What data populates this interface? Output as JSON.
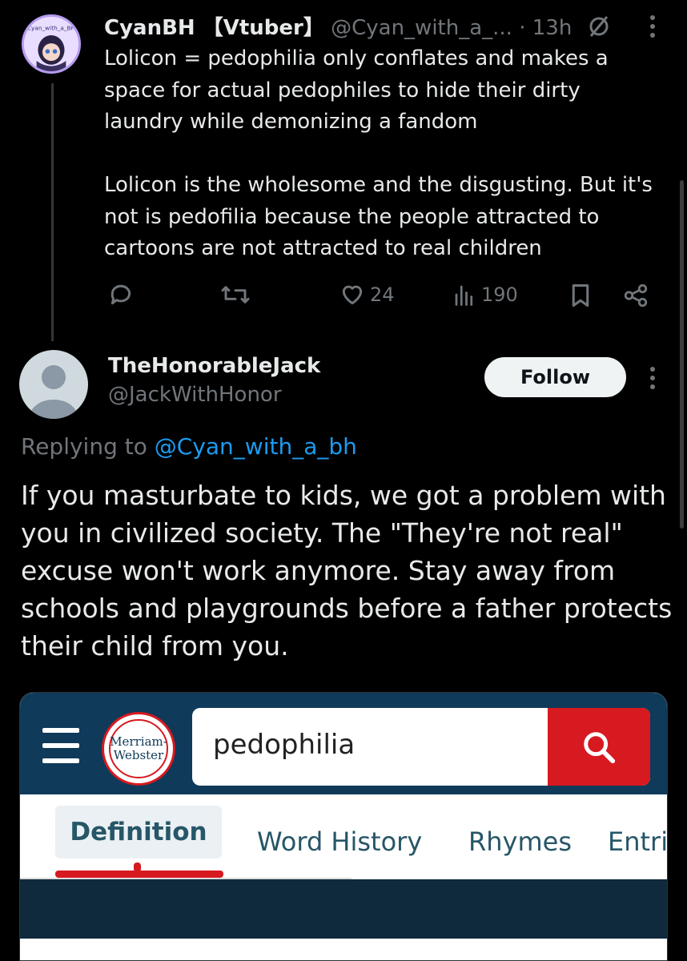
{
  "tweet": {
    "display_name": "CyanBH 【Vtuber】",
    "handle_time": "@Cyan_with_a_... · 13h",
    "avatar_text": "Cyan_with_a_BH",
    "text": "Lolicon = pedophilia only conflates and makes a\nspace for actual pedophiles to hide their dirty\nlaundry while demonizing a fandom\n\nLolicon is the wholesome and the disgusting. But it's\nnot is pedofilia because the people attracted to\ncartoons are not attracted to real children",
    "likes": "24",
    "views": "190",
    "icons": [
      "reply-icon",
      "retweet-icon",
      "heart-icon",
      "views-icon",
      "bookmark-icon",
      "share-icon",
      "grok-icon",
      "more-icon"
    ]
  },
  "reply": {
    "display_name": "TheHonorableJack",
    "handle": "@JackWithHonor",
    "follow_label": "Follow",
    "replying_prefix": "Replying to ",
    "replying_handle": "@Cyan_with_a_bh",
    "text": "If you masturbate to kids, we got a problem with\nyou in civilized society. The \"They're not real\"\nexcuse won't work anymore. Stay away from\nschools and playgrounds before a father protects\ntheir child from you."
  },
  "embed": {
    "logo_line1": "Merriam-",
    "logo_line2": "Webster",
    "search_value": "pedophilia",
    "tabs": [
      "Definition",
      "Word History",
      "Rhymes",
      "Entri"
    ],
    "colors": {
      "header": "#0f3a5a",
      "accent": "#d71920"
    }
  }
}
